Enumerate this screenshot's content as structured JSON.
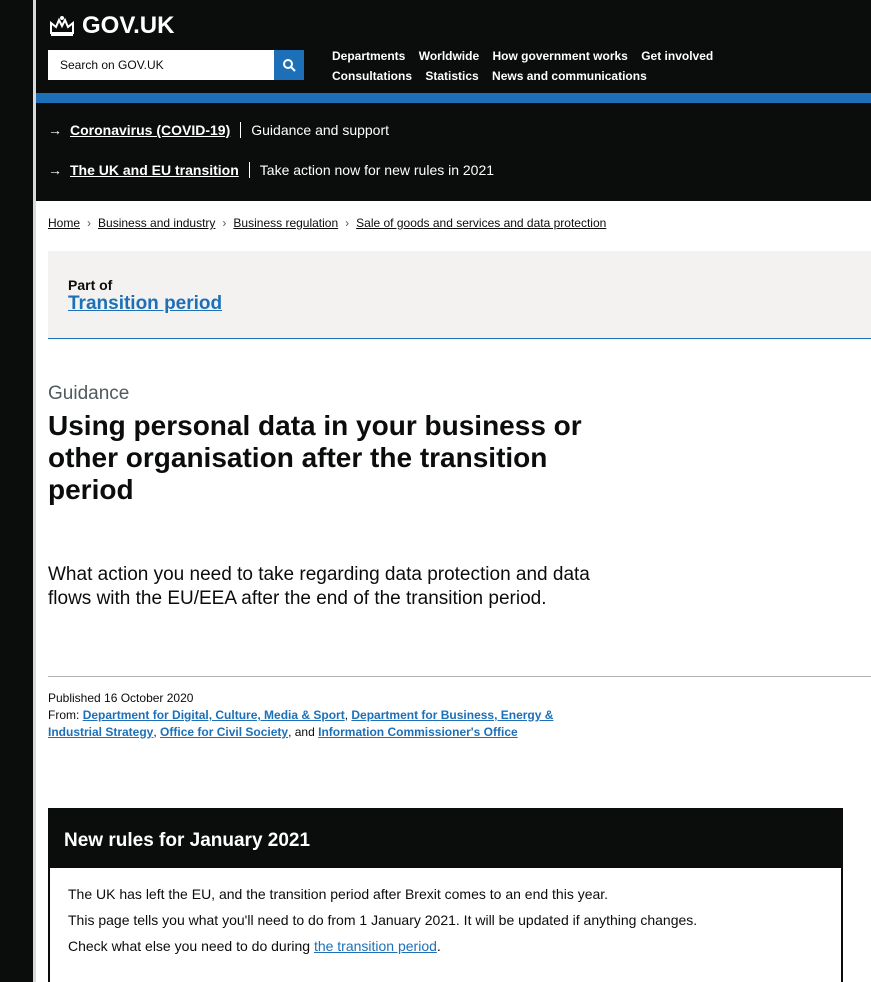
{
  "header": {
    "logo_text": "GOV.UK",
    "search_placeholder": "Search on GOV.UK",
    "nav": [
      "Departments",
      "Worldwide",
      "How government works",
      "Get involved",
      "Consultations",
      "Statistics",
      "News and communications"
    ]
  },
  "alerts": [
    {
      "link": "Coronavirus (COVID-19)",
      "text": "Guidance and support"
    },
    {
      "link": "The UK and EU transition",
      "text": "Take action now for new rules in 2021"
    }
  ],
  "breadcrumb": [
    "Home",
    "Business and industry",
    "Business regulation",
    "Sale of goods and services and data protection"
  ],
  "part_of": {
    "label": "Part of",
    "link": "Transition period"
  },
  "page": {
    "kicker": "Guidance",
    "title": "Using personal data in your business or other organisation after the transition period",
    "summary": "What action you need to take regarding data protection and data flows with the EU/EEA after the end of the transition period."
  },
  "meta": {
    "published": "Published 16 October 2020",
    "from_label": "From:",
    "orgs": [
      "Department for Digital, Culture, Media & Sport",
      "Department for Business, Energy & Industrial Strategy",
      "Office for Civil Society",
      "Information Commissioner's Office"
    ],
    "and_text": ", and"
  },
  "rules": {
    "heading": "New rules for January 2021",
    "p1": "The UK has left the EU, and the transition period after Brexit comes to an end this year.",
    "p2": "This page tells you what you'll need to do from 1 January 2021. It will be updated if anything changes.",
    "p3_prefix": "Check what else you need to do during ",
    "p3_link": "the transition period",
    "p3_suffix": "."
  },
  "colors": {
    "brand_blue": "#1d70b8",
    "black": "#0b0c0c",
    "panel_grey": "#f3f2f1"
  }
}
